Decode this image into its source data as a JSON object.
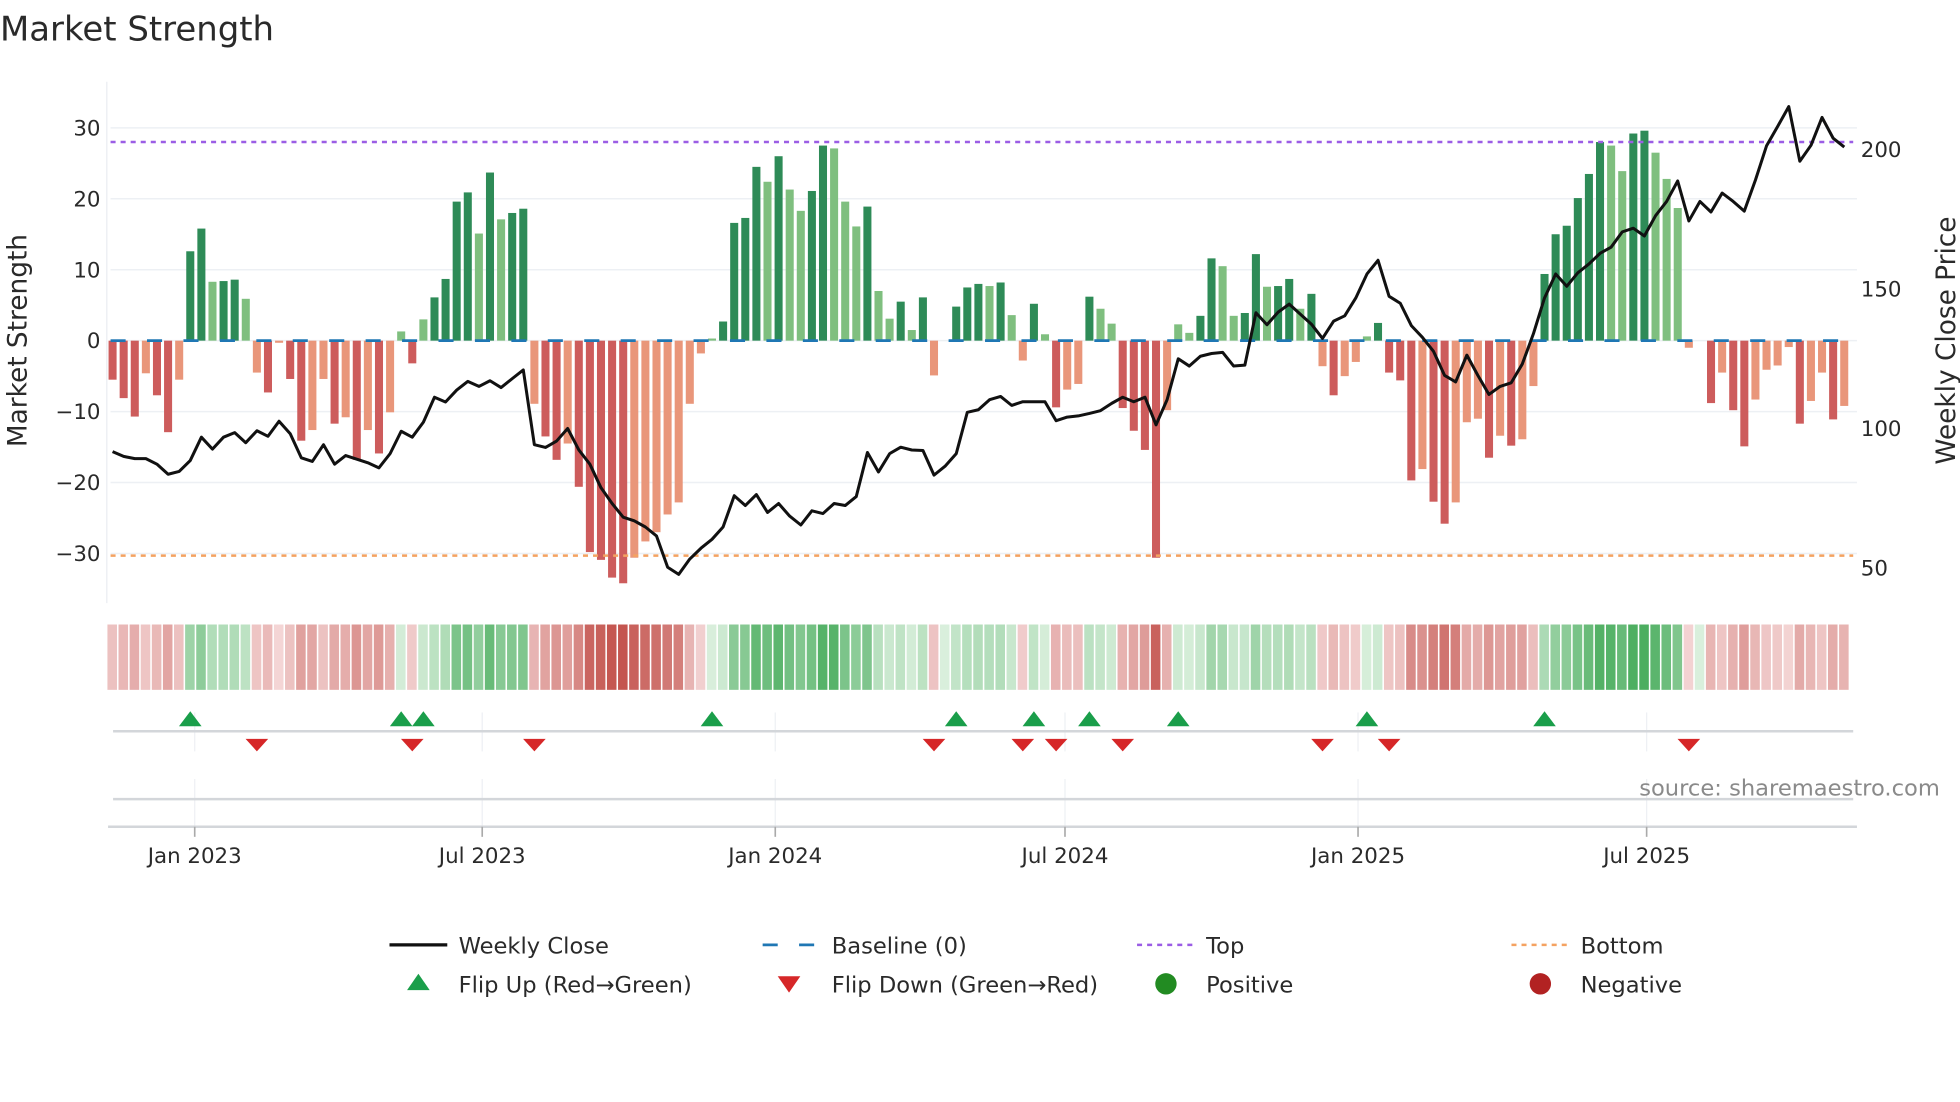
{
  "chart_data": {
    "type": "bar",
    "title": "Market Strength",
    "ylabel_left": "Market Strength",
    "ylabel_right": "Weekly Close Price",
    "ylim_left": [
      -37,
      36.5
    ],
    "ylim_right": [
      37.4,
      224.3
    ],
    "yticks_left": [
      {
        "value": 30,
        "label": "30"
      },
      {
        "value": 20,
        "label": "20"
      },
      {
        "value": 10,
        "label": "10"
      },
      {
        "value": 0,
        "label": "0"
      },
      {
        "value": -10,
        "label": "−10"
      },
      {
        "value": -20,
        "label": "−20"
      },
      {
        "value": -30,
        "label": "−30"
      }
    ],
    "yticks_right": [
      {
        "value": 200,
        "label": "200"
      },
      {
        "value": 150,
        "label": "150"
      },
      {
        "value": 100,
        "label": "100"
      },
      {
        "value": 50,
        "label": "50"
      }
    ],
    "xticks": [
      {
        "week": 7.4,
        "label": "Jan 2023"
      },
      {
        "week": 33.3,
        "label": "Jul 2023"
      },
      {
        "week": 59.7,
        "label": "Jan 2024"
      },
      {
        "week": 85.8,
        "label": "Jul 2024"
      },
      {
        "week": 112.2,
        "label": "Jan 2025"
      },
      {
        "week": 138.2,
        "label": "Jul 2025"
      }
    ],
    "top_level": 28,
    "bottom_level": -30.3,
    "baseline": 0,
    "grid": true,
    "strength": [
      -5.5,
      -8.1,
      -10.7,
      -4.6,
      -7.7,
      -12.9,
      -5.5,
      12.6,
      15.8,
      8.3,
      8.4,
      8.6,
      5.9,
      -4.5,
      -7.3,
      -0.3,
      -5.4,
      -14.1,
      -12.6,
      -5.4,
      -11.7,
      -10.8,
      -16.8,
      -12.6,
      -15.9,
      -10.1,
      1.3,
      -3.2,
      3.0,
      6.1,
      8.7,
      19.6,
      20.9,
      15.1,
      23.7,
      17.1,
      18.0,
      18.6,
      -8.9,
      -13.5,
      -16.8,
      -14.5,
      -20.6,
      -29.8,
      -30.9,
      -33.4,
      -34.2,
      -30.6,
      -28.3,
      -27.0,
      -24.5,
      -22.8,
      -8.9,
      -1.8,
      0.3,
      2.7,
      16.6,
      17.3,
      24.5,
      22.4,
      26.0,
      21.3,
      18.3,
      21.1,
      27.5,
      27.1,
      19.6,
      16.1,
      18.9,
      7.0,
      3.1,
      5.5,
      1.5,
      6.1,
      -4.9,
      0,
      4.8,
      7.5,
      8.0,
      7.7,
      8.2,
      3.6,
      -2.8,
      5.2,
      0.9,
      -9.4,
      -6.9,
      -6.1,
      6.2,
      4.5,
      2.4,
      -9.5,
      -12.7,
      -15.4,
      -30.6,
      -9.8,
      2.3,
      1.1,
      3.5,
      11.6,
      10.5,
      3.5,
      3.9,
      12.2,
      7.6,
      7.7,
      8.7,
      4.5,
      6.6,
      -3.6,
      -7.7,
      -5.0,
      -3.0,
      0.6,
      2.5,
      -4.5,
      -5.6,
      -19.7,
      -18.1,
      -22.7,
      -25.8,
      -22.8,
      -11.5,
      -11.0,
      -16.5,
      -13.4,
      -14.8,
      -13.9,
      -6.4,
      9.4,
      15.0,
      16.2,
      20.1,
      23.5,
      28.0,
      27.5,
      23.9,
      29.2,
      29.6,
      26.5,
      22.8,
      18.7,
      -1.0,
      0,
      -8.8,
      -4.5,
      -9.8,
      -14.9,
      -8.3,
      -4.1,
      -3.5,
      -0.9,
      -11.7,
      -8.5,
      -4.5,
      -11.1,
      -9.2
    ],
    "weekly_close": [
      91.7,
      90.0,
      89.2,
      89.2,
      87.2,
      83.6,
      84.6,
      88.5,
      96.9,
      92.6,
      96.9,
      98.5,
      94.9,
      99.2,
      97.2,
      102.6,
      98.1,
      89.5,
      88.2,
      94.2,
      87.2,
      90.3,
      89.0,
      87.7,
      85.9,
      91.0,
      99.0,
      96.9,
      102.3,
      111.2,
      109.5,
      113.8,
      116.9,
      115.1,
      117.1,
      114.7,
      117.9,
      121.0,
      94.2,
      93.2,
      95.5,
      100.0,
      92.3,
      87.2,
      78.8,
      73.1,
      68.2,
      66.9,
      64.7,
      61.5,
      50.3,
      47.7,
      53.2,
      57.1,
      60.3,
      64.7,
      75.9,
      72.4,
      76.3,
      69.9,
      73.1,
      68.6,
      65.4,
      70.5,
      69.5,
      73.1,
      72.4,
      75.6,
      91.4,
      84.4,
      91.0,
      93.3,
      92.3,
      92.1,
      83.3,
      86.5,
      91.0,
      105.8,
      106.7,
      110.3,
      111.5,
      108.3,
      109.6,
      109.6,
      109.6,
      102.8,
      104.1,
      104.5,
      105.4,
      106.4,
      109.0,
      111.2,
      109.6,
      111.2,
      101.3,
      110.3,
      125.0,
      122.4,
      125.9,
      126.9,
      127.3,
      122.4,
      122.7,
      141.5,
      137.2,
      141.7,
      144.6,
      141.0,
      137.4,
      132.3,
      138.5,
      140.4,
      146.8,
      155.4,
      160.3,
      147.4,
      144.9,
      136.9,
      132.7,
      127.6,
      119.0,
      116.7,
      126.3,
      119.0,
      112.2,
      115.1,
      116.4,
      123.1,
      134.0,
      146.8,
      155.4,
      151.0,
      155.8,
      159.0,
      162.8,
      165.0,
      170.5,
      171.8,
      169.0,
      176.3,
      181.4,
      188.7,
      174.4,
      181.4,
      177.6,
      184.4,
      181.4,
      177.9,
      189.1,
      201.3,
      208.3,
      215.4,
      195.8,
      201.5,
      211.5,
      204.1,
      200.9
    ],
    "legend": [
      {
        "key": "weekly_close",
        "label": "Weekly Close"
      },
      {
        "key": "baseline",
        "label": "Baseline (0)"
      },
      {
        "key": "top",
        "label": "Top"
      },
      {
        "key": "bottom",
        "label": "Bottom"
      },
      {
        "key": "flip_up",
        "label": "Flip Up (Red→Green)"
      },
      {
        "key": "flip_down",
        "label": "Flip Down (Green→Red)"
      },
      {
        "key": "positive",
        "label": "Positive"
      },
      {
        "key": "negative",
        "label": "Negative"
      }
    ],
    "legend_placement": "bottom"
  },
  "colors": {
    "pos_rising": "#2e8b57",
    "pos_falling": "#7fbf7f",
    "neg_rising": "#cd5c5c",
    "neg_falling": "#e9967a",
    "baseline": "#1f77b4",
    "top": "#9b5de5",
    "bottom": "#f4a261",
    "line": "#111111",
    "flip_up": "#1a9e4a",
    "flip_down": "#d62728",
    "positive": "#228b22",
    "negative": "#b22222"
  },
  "source": "source: sharemaestro.com"
}
